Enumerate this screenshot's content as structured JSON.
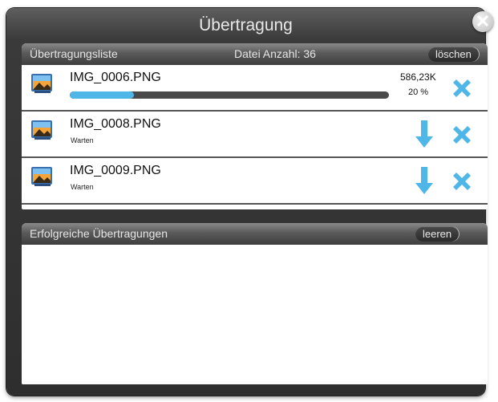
{
  "dialog": {
    "title": "Übertragung",
    "close_glyph": "✕"
  },
  "transfer_list": {
    "header_label": "Übertragungsliste",
    "file_count": "Datei Anzahl: 36",
    "clear_label": "löschen",
    "items": [
      {
        "name": "IMG_0006.PNG",
        "size": "586,23K",
        "percent_label": "20 %",
        "progress": 0.2,
        "state": "uploading"
      },
      {
        "name": "IMG_0008.PNG",
        "status": "Warten",
        "state": "waiting"
      },
      {
        "name": "IMG_0009.PNG",
        "status": "Warten",
        "state": "waiting"
      }
    ]
  },
  "successful": {
    "header_label": "Erfolgreiche Übertragungen",
    "clear_label": "leeren"
  },
  "colors": {
    "accent_blue": "#4fb6e8",
    "dialog_dark": "#2e2e2e"
  },
  "icons": {
    "file": "image-file-icon",
    "cancel": "close-x-icon",
    "download": "download-arrow-icon"
  }
}
